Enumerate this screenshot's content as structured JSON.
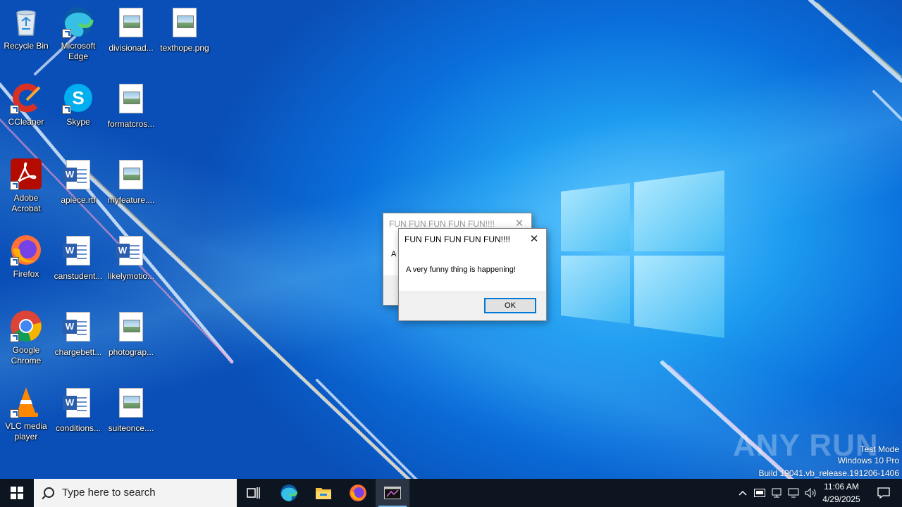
{
  "desktop": {
    "icons": [
      {
        "label": "Recycle Bin",
        "icon": "recycle-bin-icon"
      },
      {
        "label": "Microsoft Edge",
        "icon": "edge-icon"
      },
      {
        "label": "divisionad...",
        "icon": "image-file-icon"
      },
      {
        "label": "texthope.png",
        "icon": "image-file-icon"
      },
      {
        "label": "CCleaner",
        "icon": "ccleaner-icon"
      },
      {
        "label": "Skype",
        "icon": "skype-icon"
      },
      {
        "label": "formatcros...",
        "icon": "image-file-icon"
      },
      {
        "label": "Adobe Acrobat",
        "icon": "acrobat-icon"
      },
      {
        "label": "apiece.rtf",
        "icon": "word-file-icon"
      },
      {
        "label": "myfeature....",
        "icon": "image-file-icon"
      },
      {
        "label": "Firefox",
        "icon": "firefox-icon"
      },
      {
        "label": "canstudent...",
        "icon": "word-file-icon"
      },
      {
        "label": "likelymotio...",
        "icon": "word-file-icon"
      },
      {
        "label": "Google Chrome",
        "icon": "chrome-icon"
      },
      {
        "label": "chargebett...",
        "icon": "word-file-icon"
      },
      {
        "label": "photograp...",
        "icon": "image-file-icon"
      },
      {
        "label": "VLC media player",
        "icon": "vlc-icon"
      },
      {
        "label": "conditions...",
        "icon": "word-file-icon"
      },
      {
        "label": "suiteonce....",
        "icon": "image-file-icon"
      }
    ]
  },
  "dialog_back": {
    "title": "FUN FUN FUN FUN FUN!!!!",
    "message_fragment": "A"
  },
  "dialog_front": {
    "title": "FUN FUN FUN FUN FUN!!!!",
    "message": "A very funny thing is happening!",
    "ok_label": "OK"
  },
  "watermark": {
    "brand": "ANY RUN",
    "line1": "Test Mode",
    "line2": "Windows 10 Pro",
    "line3": "Build 19041.vb_release.191206-1406"
  },
  "taskbar": {
    "search_placeholder": "Type here to search",
    "time": "11:06 AM",
    "date": "4/29/2025",
    "colors": {
      "bg": "#0c1520",
      "accent": "#76b9ed"
    }
  }
}
